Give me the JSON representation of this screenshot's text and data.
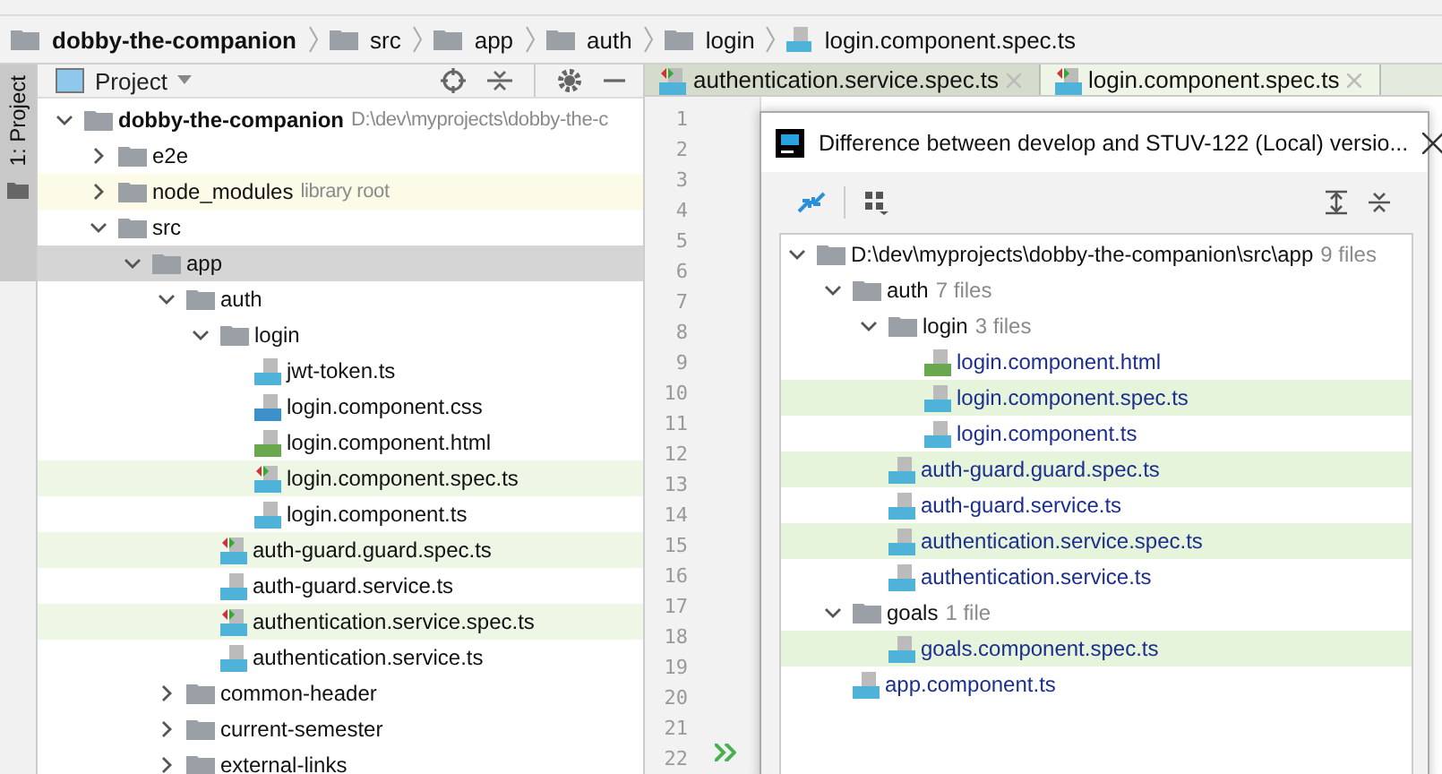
{
  "breadcrumbs": [
    {
      "label": "dobby-the-companion",
      "kind": "folder",
      "bold": true
    },
    {
      "label": "src",
      "kind": "folder",
      "bold": false
    },
    {
      "label": "app",
      "kind": "folder",
      "bold": false
    },
    {
      "label": "auth",
      "kind": "folder",
      "bold": false
    },
    {
      "label": "login",
      "kind": "folder",
      "bold": false
    },
    {
      "label": "login.component.spec.ts",
      "kind": "ts",
      "bold": false
    }
  ],
  "tool_strip": {
    "label": "1: Project"
  },
  "project_panel": {
    "title": "Project",
    "tree": [
      {
        "name": "dobby-the-companion",
        "hint": "D:\\dev\\myprojects\\dobby-the-c",
        "kind": "folder",
        "bold": true,
        "expanded": true,
        "selected": false,
        "changed": false,
        "children": [
          {
            "name": "e2e",
            "kind": "folder",
            "bold": false,
            "expanded": false,
            "selected": false,
            "changed": false
          },
          {
            "name": "node_modules",
            "hint": "library root",
            "kind": "library",
            "bold": false,
            "expanded": false,
            "selected": false,
            "changed": false
          },
          {
            "name": "src",
            "kind": "folder",
            "bold": false,
            "expanded": true,
            "selected": false,
            "changed": false,
            "children": [
              {
                "name": "app",
                "kind": "folder",
                "bold": false,
                "expanded": true,
                "selected": true,
                "changed": false,
                "children": [
                  {
                    "name": "auth",
                    "kind": "folder",
                    "bold": false,
                    "expanded": true,
                    "selected": false,
                    "changed": false,
                    "children": [
                      {
                        "name": "login",
                        "kind": "folder",
                        "bold": false,
                        "expanded": true,
                        "selected": false,
                        "changed": false,
                        "children": [
                          {
                            "name": "jwt-token.ts",
                            "kind": "ts",
                            "bold": false,
                            "selected": false,
                            "changed": false
                          },
                          {
                            "name": "login.component.css",
                            "kind": "css",
                            "bold": false,
                            "selected": false,
                            "changed": false
                          },
                          {
                            "name": "login.component.html",
                            "kind": "html",
                            "bold": false,
                            "selected": false,
                            "changed": false
                          },
                          {
                            "name": "login.component.spec.ts",
                            "kind": "ts",
                            "bold": false,
                            "selected": false,
                            "changed": true
                          },
                          {
                            "name": "login.component.ts",
                            "kind": "ts",
                            "bold": false,
                            "selected": false,
                            "changed": false
                          }
                        ]
                      },
                      {
                        "name": "auth-guard.guard.spec.ts",
                        "kind": "ts",
                        "bold": false,
                        "selected": false,
                        "changed": true
                      },
                      {
                        "name": "auth-guard.service.ts",
                        "kind": "ts",
                        "bold": false,
                        "selected": false,
                        "changed": false
                      },
                      {
                        "name": "authentication.service.spec.ts",
                        "kind": "ts",
                        "bold": false,
                        "selected": false,
                        "changed": true
                      },
                      {
                        "name": "authentication.service.ts",
                        "kind": "ts",
                        "bold": false,
                        "selected": false,
                        "changed": false
                      }
                    ]
                  },
                  {
                    "name": "common-header",
                    "kind": "folder",
                    "bold": false,
                    "expanded": false,
                    "selected": false,
                    "changed": false
                  },
                  {
                    "name": "current-semester",
                    "kind": "folder",
                    "bold": false,
                    "expanded": false,
                    "selected": false,
                    "changed": false
                  },
                  {
                    "name": "external-links",
                    "kind": "folder",
                    "bold": false,
                    "expanded": false,
                    "selected": false,
                    "changed": false
                  }
                ]
              }
            ]
          }
        ]
      }
    ]
  },
  "editor_tabs": [
    {
      "label": "authentication.service.spec.ts",
      "selected": false
    },
    {
      "label": "login.component.spec.ts",
      "selected": true
    }
  ],
  "line_numbers": [
    "1",
    "2",
    "3",
    "4",
    "5",
    "6",
    "7",
    "8",
    "9",
    "10",
    "11",
    "12",
    "13",
    "14",
    "15",
    "16",
    "17",
    "18",
    "19",
    "20",
    "21",
    "22"
  ],
  "diff_dialog": {
    "title": "Difference between develop and STUV-122 (Local) versio...",
    "tree": [
      {
        "name": "D:\\dev\\myprojects\\dobby-the-companion\\src\\app",
        "hint": "9 files",
        "kind": "folder",
        "expanded": true,
        "changed": false,
        "children": [
          {
            "name": "auth",
            "hint": "7 files",
            "kind": "folder",
            "expanded": true,
            "changed": false,
            "children": [
              {
                "name": "login",
                "hint": "3 files",
                "kind": "folder",
                "expanded": true,
                "changed": false,
                "children": [
                  {
                    "name": "login.component.html",
                    "kind": "html",
                    "changed": false
                  },
                  {
                    "name": "login.component.spec.ts",
                    "kind": "ts",
                    "changed": true
                  },
                  {
                    "name": "login.component.ts",
                    "kind": "ts",
                    "changed": false
                  }
                ]
              },
              {
                "name": "auth-guard.guard.spec.ts",
                "kind": "ts",
                "changed": true
              },
              {
                "name": "auth-guard.service.ts",
                "kind": "ts",
                "changed": false
              },
              {
                "name": "authentication.service.spec.ts",
                "kind": "ts",
                "changed": true
              },
              {
                "name": "authentication.service.ts",
                "kind": "ts",
                "changed": false
              }
            ]
          },
          {
            "name": "goals",
            "hint": "1 file",
            "kind": "folder",
            "expanded": true,
            "changed": false,
            "children": [
              {
                "name": "goals.component.spec.ts",
                "kind": "ts",
                "changed": true
              }
            ]
          },
          {
            "name": "app.component.ts",
            "kind": "ts",
            "changed": false
          }
        ]
      }
    ]
  }
}
